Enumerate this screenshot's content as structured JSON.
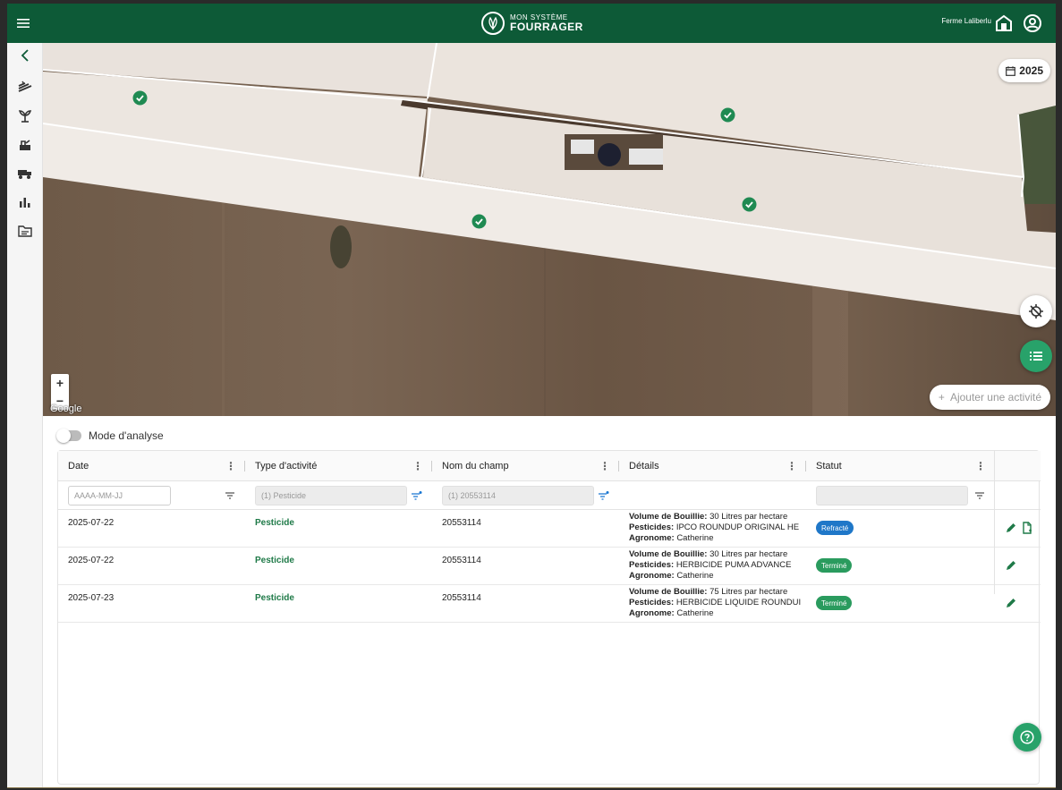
{
  "header": {
    "logo_small": "MON SYSTÈME",
    "logo_big": "FOURRAGER",
    "farm_name": "Ferme Laliberlu"
  },
  "map": {
    "year": "2025",
    "add_activity": "Ajouter une activité",
    "zoom_in": "+",
    "zoom_out": "−",
    "attribution": "Google"
  },
  "analysis": {
    "label": "Mode d'analyse"
  },
  "table": {
    "columns": [
      "Date",
      "Type d'activité",
      "Nom du champ",
      "Détails",
      "Statut"
    ],
    "filters": {
      "date_placeholder": "AAAA-MM-JJ",
      "type_value": "(1) Pesticide",
      "field_value": "(1) 20553114"
    },
    "detail_labels": {
      "volume": "Volume de Bouillie:",
      "pesticides": "Pesticides:",
      "agronome": "Agronome:"
    },
    "rows": [
      {
        "date": "2025-07-22",
        "type": "Pesticide",
        "field": "20553114",
        "volume": "30 Litres par hectare",
        "pesticides": "IPCO ROUNDUP ORIGINAL HE",
        "agronome": "Catherine",
        "status": "Refracté",
        "status_color": "#1f77c8"
      },
      {
        "date": "2025-07-22",
        "type": "Pesticide",
        "field": "20553114",
        "volume": "30 Litres par hectare",
        "pesticides": "HERBICIDE PUMA ADVANCE",
        "agronome": "Catherine",
        "status": "Terminé",
        "status_color": "#2a9b5e"
      },
      {
        "date": "2025-07-23",
        "type": "Pesticide",
        "field": "20553114",
        "volume": "75 Litres par hectare",
        "pesticides": "HERBICIDE LIQUIDE ROUNDUI",
        "agronome": "Catherine",
        "status": "Terminé",
        "status_color": "#2a9b5e"
      }
    ]
  },
  "colors": {
    "brand": "#0d5a37",
    "accent": "#28a26a",
    "link": "#1f7a48"
  },
  "icons": [
    "menu-icon",
    "barn-icon",
    "account-icon",
    "back-icon",
    "calendar-icon",
    "locate-icon",
    "list-icon",
    "help-icon",
    "edit-icon",
    "document-icon",
    "filter-icon"
  ]
}
